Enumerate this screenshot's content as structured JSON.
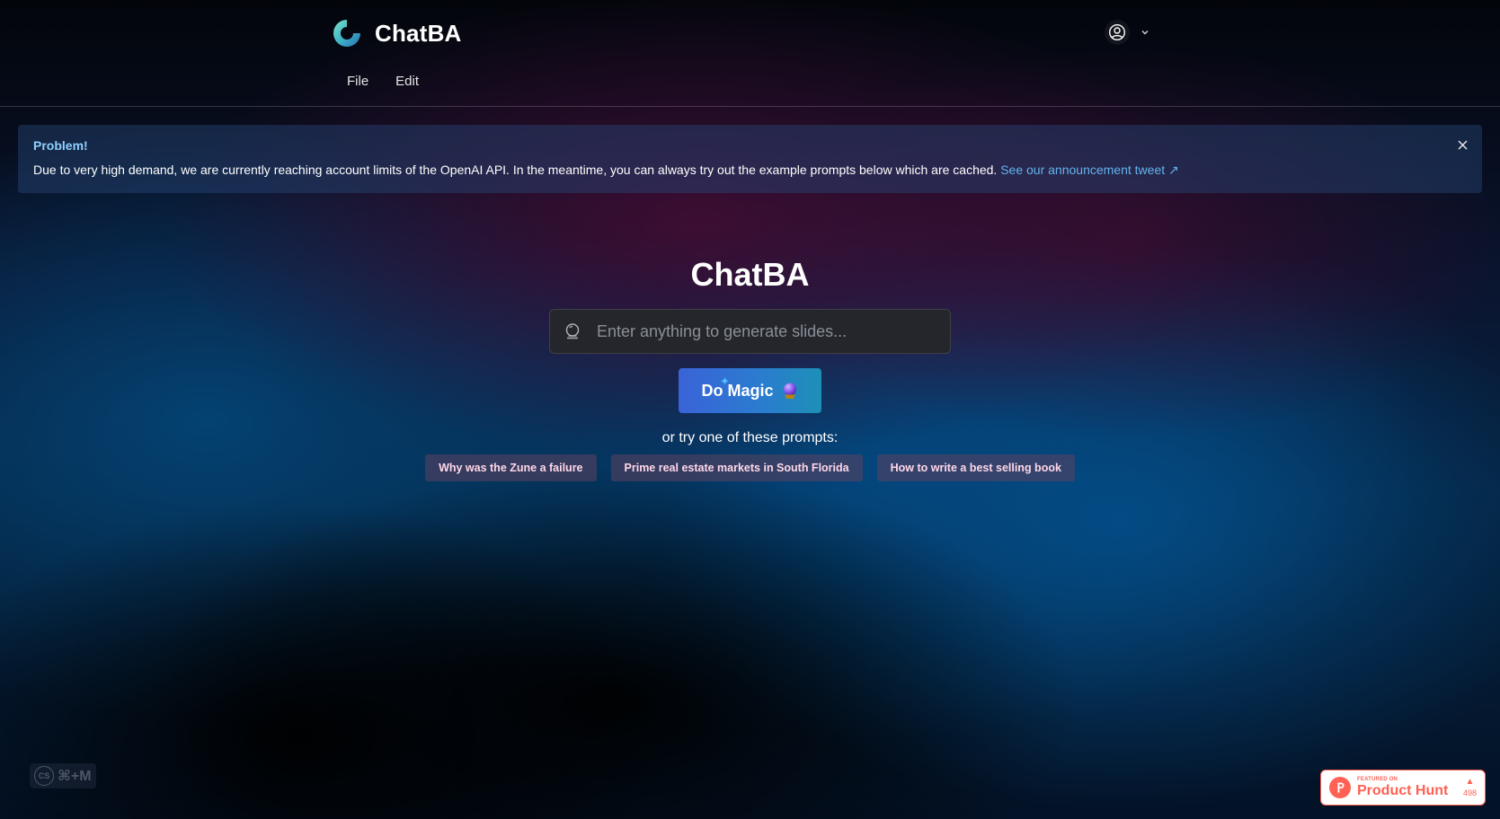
{
  "app": {
    "name": "ChatBA"
  },
  "menu": {
    "items": [
      "File",
      "Edit"
    ]
  },
  "user_menu": {
    "icon": "user-circle-icon",
    "chevron": "chevron-down-icon"
  },
  "alert": {
    "title": "Problem!",
    "message": "Due to very high demand, we are currently reaching account limits of the OpenAI API. In the meantime, you can always try out the example prompts below which are cached.",
    "link_text": "See our announcement tweet ↗",
    "close_icon": "close-icon"
  },
  "hero": {
    "title": "ChatBA",
    "search_placeholder": "Enter anything to generate slides...",
    "search_value": "",
    "button_label": "Do Magic",
    "try_text": "or try one of these prompts:",
    "prompts": [
      "Why was the Zune a failure",
      "Prime real estate markets in South Florida",
      "How to write a best selling book"
    ]
  },
  "shortcut": {
    "badge": "CS",
    "keys": "⌘+M"
  },
  "product_hunt": {
    "small_label": "FEATURED ON",
    "big_label": "Product Hunt",
    "votes": "498",
    "arrow": "▲"
  },
  "colors": {
    "accent": "#63b3ed",
    "alert_title": "#8fd0ff",
    "button_start": "#3a63d8",
    "button_end": "#1e8fb8",
    "prompt_text": "#ffd7e8",
    "product_hunt": "#ff6154"
  }
}
